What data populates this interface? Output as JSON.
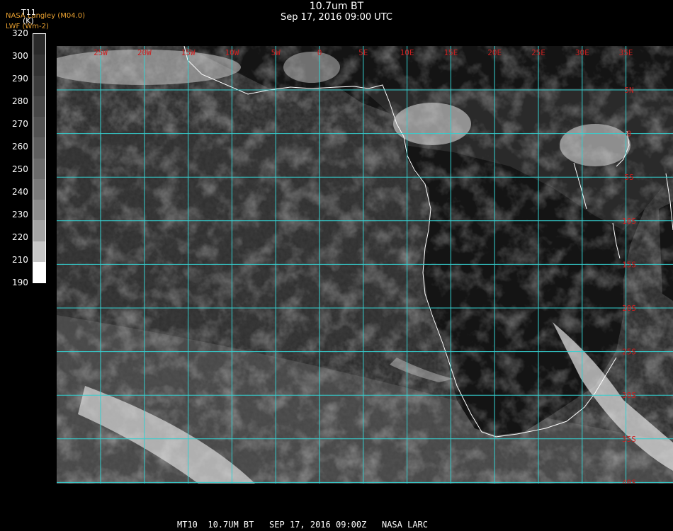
{
  "header": {
    "title": "10.7um BT",
    "subtitle": "Sep 17, 2016 09:00 UTC",
    "credit_line1": "NASA Langley (M04.0)",
    "credit_line2": "LWF (Wm-2)"
  },
  "colorbar": {
    "title": "T11",
    "unit": "(K)",
    "ticks": [
      "320",
      "300",
      "290",
      "280",
      "270",
      "260",
      "250",
      "240",
      "230",
      "220",
      "210",
      "190"
    ],
    "shades": [
      "#2a2a2a",
      "#333333",
      "#3d3d3d",
      "#474747",
      "#525252",
      "#5e5e5e",
      "#6b6b6b",
      "#7a7a7a",
      "#8c8c8c",
      "#a3a3a3",
      "#c6c6c6",
      "#ffffff"
    ]
  },
  "map": {
    "lon_labels": [
      "25W",
      "20W",
      "15W",
      "10W",
      "5W",
      "0",
      "5E",
      "10E",
      "15E",
      "20E",
      "25E",
      "30E",
      "35E"
    ],
    "lat_labels": [
      "5N",
      "0",
      "5S",
      "10S",
      "15S",
      "20S",
      "25S",
      "30S",
      "35S",
      "40S"
    ],
    "grid_color": "#34d0d0",
    "label_color": "#cc2020",
    "coast_color": "#ffffff"
  },
  "footer": {
    "text": "MT10  10.7UM BT   SEP 17, 2016 09:00Z   NASA LARC"
  }
}
